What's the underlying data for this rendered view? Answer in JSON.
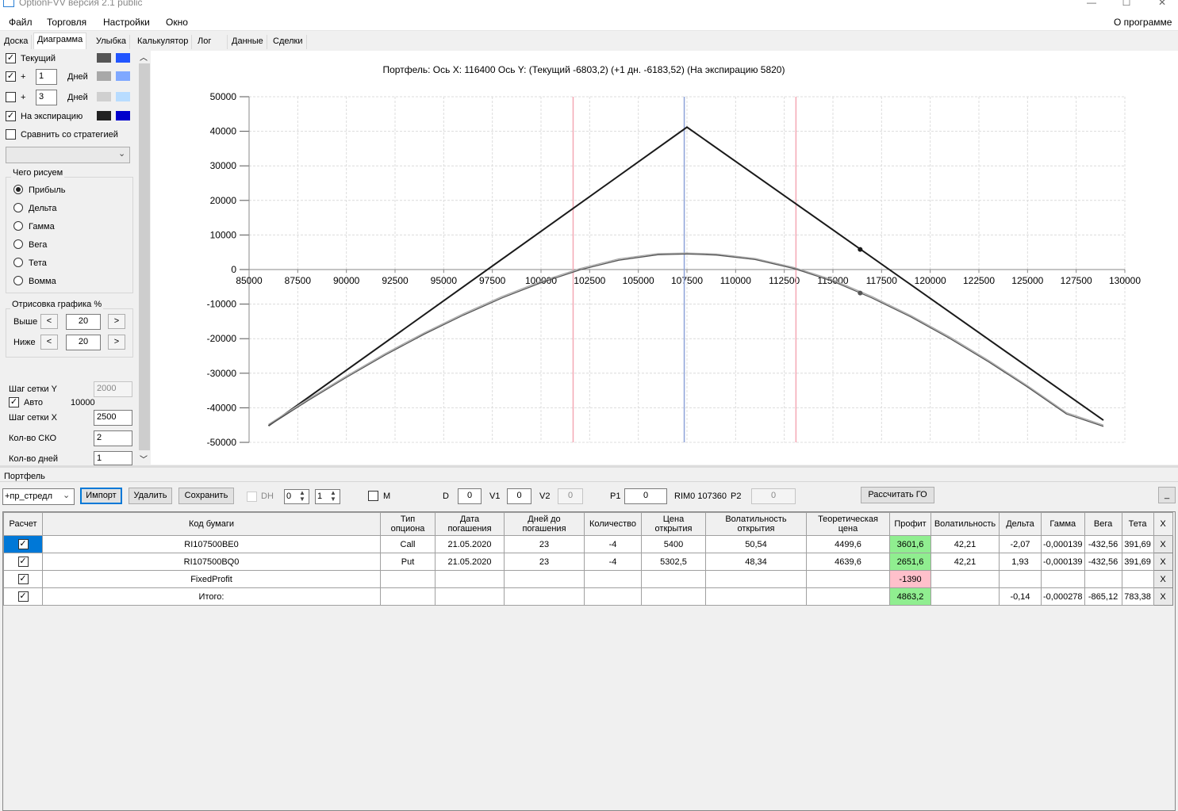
{
  "window": {
    "title": "OptionFVV версия 2.1 public",
    "minimize": "—",
    "maximize": "☐",
    "close": "✕"
  },
  "menu": {
    "items": [
      "Файл",
      "Торговля",
      "Настройки",
      "Окно"
    ],
    "about": "О программе"
  },
  "tabs": [
    "Доска",
    "Диаграмма",
    "Улыбка",
    "Калькулятор",
    "Лог",
    "Данные",
    "Сделки"
  ],
  "active_tab": "Диаграмма",
  "left_panel": {
    "current": {
      "label": "Текущий",
      "checked": true,
      "color1": "#555555",
      "color2": "#2255ff"
    },
    "plus1": {
      "prefix": "+",
      "value": "1",
      "unit": "Дней",
      "checked": true,
      "color1": "#a8a8a8",
      "color2": "#7fa8ff"
    },
    "plus3": {
      "prefix": "+",
      "value": "3",
      "unit": "Дней",
      "checked": false,
      "color1": "#d0d0d0",
      "color2": "#b8dcff"
    },
    "expiry": {
      "label": "На экспирацию",
      "checked": true,
      "color1": "#222222",
      "color2": "#0000cc"
    },
    "compare": {
      "label": "Сравнить со стратегией",
      "checked": false
    },
    "strategy_select": "",
    "draw_group": {
      "title": "Чего рисуем",
      "options": [
        "Прибыль",
        "Дельта",
        "Гамма",
        "Вега",
        "Тета",
        "Вомма"
      ],
      "selected": "Прибыль"
    },
    "percent_group": {
      "title": "Отрисовка графика %",
      "above_label": "Выше",
      "above_value": "20",
      "below_label": "Ниже",
      "below_value": "20",
      "dec": "<",
      "inc": ">"
    },
    "grid_step_y_label": "Шаг сетки Y",
    "grid_step_y_value": "2000",
    "auto_label": "Авто",
    "auto_checked": true,
    "auto_value": "10000",
    "grid_step_x_label": "Шаг сетки X",
    "grid_step_x_value": "2500",
    "sko_label": "Кол-во СКО",
    "sko_value": "2",
    "days_label": "Кол-во дней",
    "days_value": "1",
    "scroll_up": "︿",
    "scroll_down": "﹀"
  },
  "chart_data": {
    "type": "line",
    "title": "Портфель:  Ось X:  116400  Ось Y:   (Текущий -6803,2)   (+1 дн.  -6183,52)   (На экспирацию 5820)",
    "xlim": [
      85000,
      130000
    ],
    "ylim": [
      -50000,
      50000
    ],
    "x_ticks": [
      85000,
      87500,
      90000,
      92500,
      95000,
      97500,
      100000,
      102500,
      105000,
      107500,
      110000,
      112500,
      115000,
      117500,
      120000,
      122500,
      125000,
      127500,
      130000
    ],
    "y_ticks": [
      50000,
      40000,
      30000,
      20000,
      10000,
      0,
      -10000,
      -20000,
      -30000,
      -40000,
      -50000
    ],
    "grid": true,
    "vertical_lines": [
      {
        "x": 101650,
        "color": "#f4a8b4"
      },
      {
        "x": 107360,
        "color": "#8da2d8"
      },
      {
        "x": 113100,
        "color": "#f4a8b4"
      }
    ],
    "series": [
      {
        "color": "#1a1a1a",
        "x": [
          86000,
          107500,
          128900
        ],
        "y": [
          -45200,
          41200,
          -43600
        ]
      },
      {
        "color": "#a8a8a8",
        "x": [
          86000,
          88000,
          90000,
          92000,
          94000,
          96000,
          98000,
          100000,
          102000,
          104000,
          106000,
          107500,
          109000,
          111000,
          113000,
          115000,
          117000,
          119000,
          121000,
          123000,
          125000,
          127000,
          128900
        ],
        "y": [
          -44800,
          -37600,
          -30800,
          -24300,
          -18300,
          -12800,
          -7800,
          -3400,
          300,
          3100,
          4600,
          4800,
          4500,
          3200,
          600,
          -3000,
          -7800,
          -13300,
          -19500,
          -26300,
          -33600,
          -41400,
          -45000
        ]
      },
      {
        "color": "#555555",
        "x": [
          86000,
          88000,
          90000,
          92000,
          94000,
          96000,
          98000,
          100000,
          102000,
          104000,
          106000,
          107500,
          109000,
          111000,
          113000,
          115000,
          117000,
          119000,
          121000,
          123000,
          125000,
          127000,
          128900
        ],
        "y": [
          -45200,
          -38000,
          -31200,
          -24700,
          -18700,
          -13200,
          -8200,
          -3800,
          -100,
          2700,
          4300,
          4500,
          4200,
          2900,
          300,
          -3400,
          -8200,
          -13700,
          -19900,
          -26700,
          -34000,
          -41800,
          -45400
        ]
      }
    ],
    "markers": [
      {
        "x": 116400,
        "y": 5820,
        "color": "#1a1a1a"
      },
      {
        "x": 116400,
        "y": -6803,
        "color": "#555555"
      }
    ]
  },
  "portfolio": {
    "title": "Портфель",
    "name": "+пр_стредл",
    "import": "Импорт",
    "delete": "Удалить",
    "save": "Сохранить",
    "dh_label": "DH",
    "spin1": "0",
    "spin2": "1",
    "m_label": "M",
    "d_label": "D",
    "d_value": "0",
    "v1_label": "V1",
    "v1_value": "0",
    "v2_label": "V2",
    "v2_value": "0",
    "p1_label": "P1",
    "p1_value": "0",
    "rim_label": "RIM0 107360",
    "p2_label": "P2",
    "p2_value": "0",
    "calc_go": "Рассчитать ГО",
    "minimize": "_"
  },
  "table": {
    "headers": [
      "Расчет",
      "Код бумаги",
      "Тип опциона",
      "Дата погашения",
      "Дней до погашения",
      "Количество",
      "Цена открытия",
      "Волатильность открытия",
      "Теоретическая цена",
      "Профит",
      "Волатильность",
      "Дельта",
      "Гамма",
      "Вега",
      "Тета",
      "X"
    ],
    "rows": [
      {
        "calc": true,
        "code": "RI107500BE0",
        "type": "Call",
        "date": "21.05.2020",
        "days": "23",
        "qty": "-4",
        "price": "5400",
        "vol_open": "50,54",
        "theo": "4499,6",
        "profit": "3601,6",
        "profit_color": "green",
        "vol": "42,21",
        "delta": "-2,07",
        "gamma": "-0,000139",
        "vega": "-432,56",
        "theta": "391,69",
        "x": "X"
      },
      {
        "calc": true,
        "code": "RI107500BQ0",
        "type": "Put",
        "date": "21.05.2020",
        "days": "23",
        "qty": "-4",
        "price": "5302,5",
        "vol_open": "48,34",
        "theo": "4639,6",
        "profit": "2651,6",
        "profit_color": "green",
        "vol": "42,21",
        "delta": "1,93",
        "gamma": "-0,000139",
        "vega": "-432,56",
        "theta": "391,69",
        "x": "X"
      },
      {
        "calc": true,
        "code": "FixedProfit",
        "type": "",
        "date": "",
        "days": "",
        "qty": "",
        "price": "",
        "vol_open": "",
        "theo": "",
        "profit": "-1390",
        "profit_color": "pink",
        "vol": "",
        "delta": "",
        "gamma": "",
        "vega": "",
        "theta": "",
        "x": "X"
      },
      {
        "calc": true,
        "code": "Итого:",
        "type": "",
        "date": "",
        "days": "",
        "qty": "",
        "price": "",
        "vol_open": "",
        "theo": "",
        "profit": "4863,2",
        "profit_color": "green",
        "vol": "",
        "delta": "-0,14",
        "gamma": "-0,000278",
        "vega": "-865,12",
        "theta": "783,38",
        "x": "X"
      }
    ]
  }
}
